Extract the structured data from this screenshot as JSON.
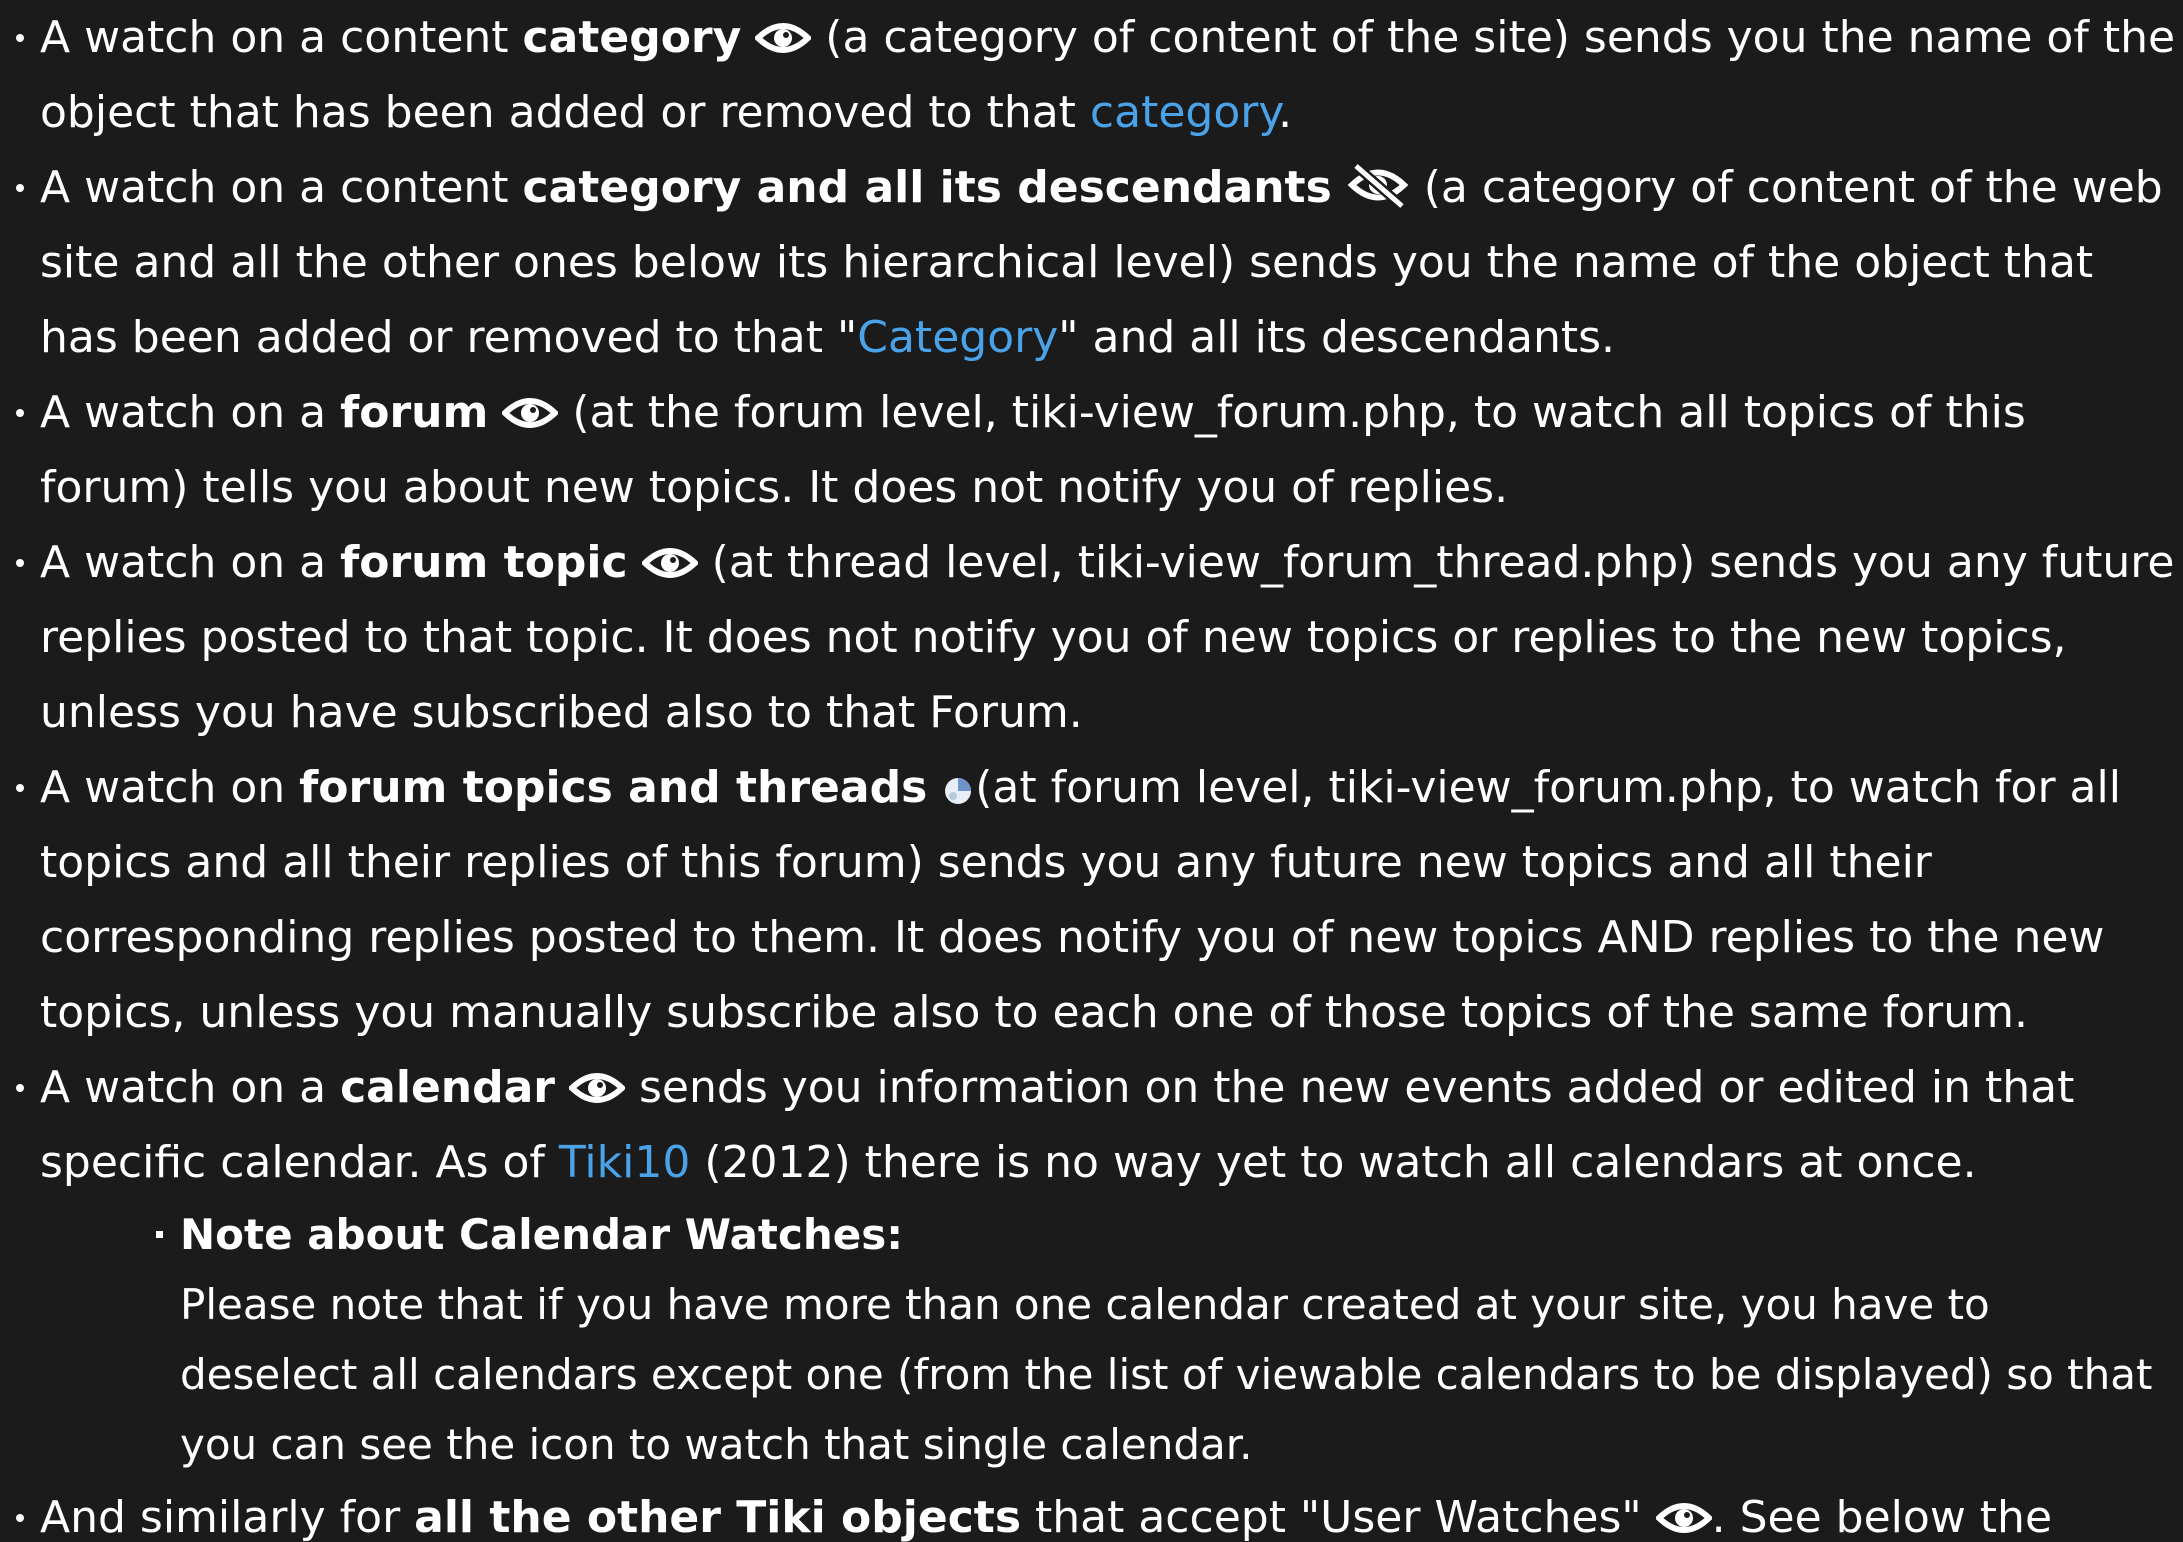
{
  "items": [
    {
      "prefix": "A watch on a content ",
      "bold": "category",
      "icon": "eye-icon",
      "text1": " (a category of content of the site) sends you the name of the object that has been added or removed to that ",
      "link": "category",
      "text2": "."
    },
    {
      "prefix": "A watch on a content ",
      "bold": "category and all its descendants",
      "icon": "eye-slash-icon",
      "text1": " (a category of content of the web site and all the other ones below its hierarchical level) sends you the name of the object that has been added or removed to that \"",
      "link": "Category",
      "text2": "\" and all its descendants."
    },
    {
      "prefix": "A watch on a ",
      "bold": "forum",
      "icon": "eye-icon",
      "text1": " (at the forum level, tiki-view_forum.php, to watch all topics of this forum) tells you about new topics. It does not notify you of replies."
    },
    {
      "prefix": "A watch on a ",
      "bold": "forum topic",
      "icon": "eye-icon",
      "text1": " (at thread level, tiki-view_forum_thread.php) sends you any future replies posted to that topic. It does not notify you of new topics or replies to the new topics, unless you have subscribed also to that Forum."
    },
    {
      "prefix": "A watch on ",
      "bold": "forum topics and threads",
      "icon": "watch-topics-threads-icon",
      "text1": "(at forum level, tiki-view_forum.php, to watch for all topics and all their replies of this forum) sends you any future new topics and all their corresponding replies posted to them. It does notify you of new topics AND replies to the new topics, unless you manually subscribe also to each one of those topics of the same forum."
    },
    {
      "prefix": "A watch on a ",
      "bold": "calendar",
      "icon": "eye-icon",
      "text1": " sends you information on the new events added or edited in that specific calendar. As of ",
      "link": "Tiki10",
      "text2": " (2012) there is no way yet to watch all calendars at once.",
      "note": {
        "title": "Note about Calendar Watches:",
        "body": "Please note that if you have more than one calendar created at your site, you have to deselect all calendars except one (from the list of viewable calendars to be displayed) so that you can see the icon to watch that single calendar."
      }
    },
    {
      "prefix": "And similarly for ",
      "bold": "all the other Tiki objects",
      "text1": " that accept \"User Watches\" ",
      "icon": "eye-icon",
      "text2": ". See below the"
    }
  ]
}
